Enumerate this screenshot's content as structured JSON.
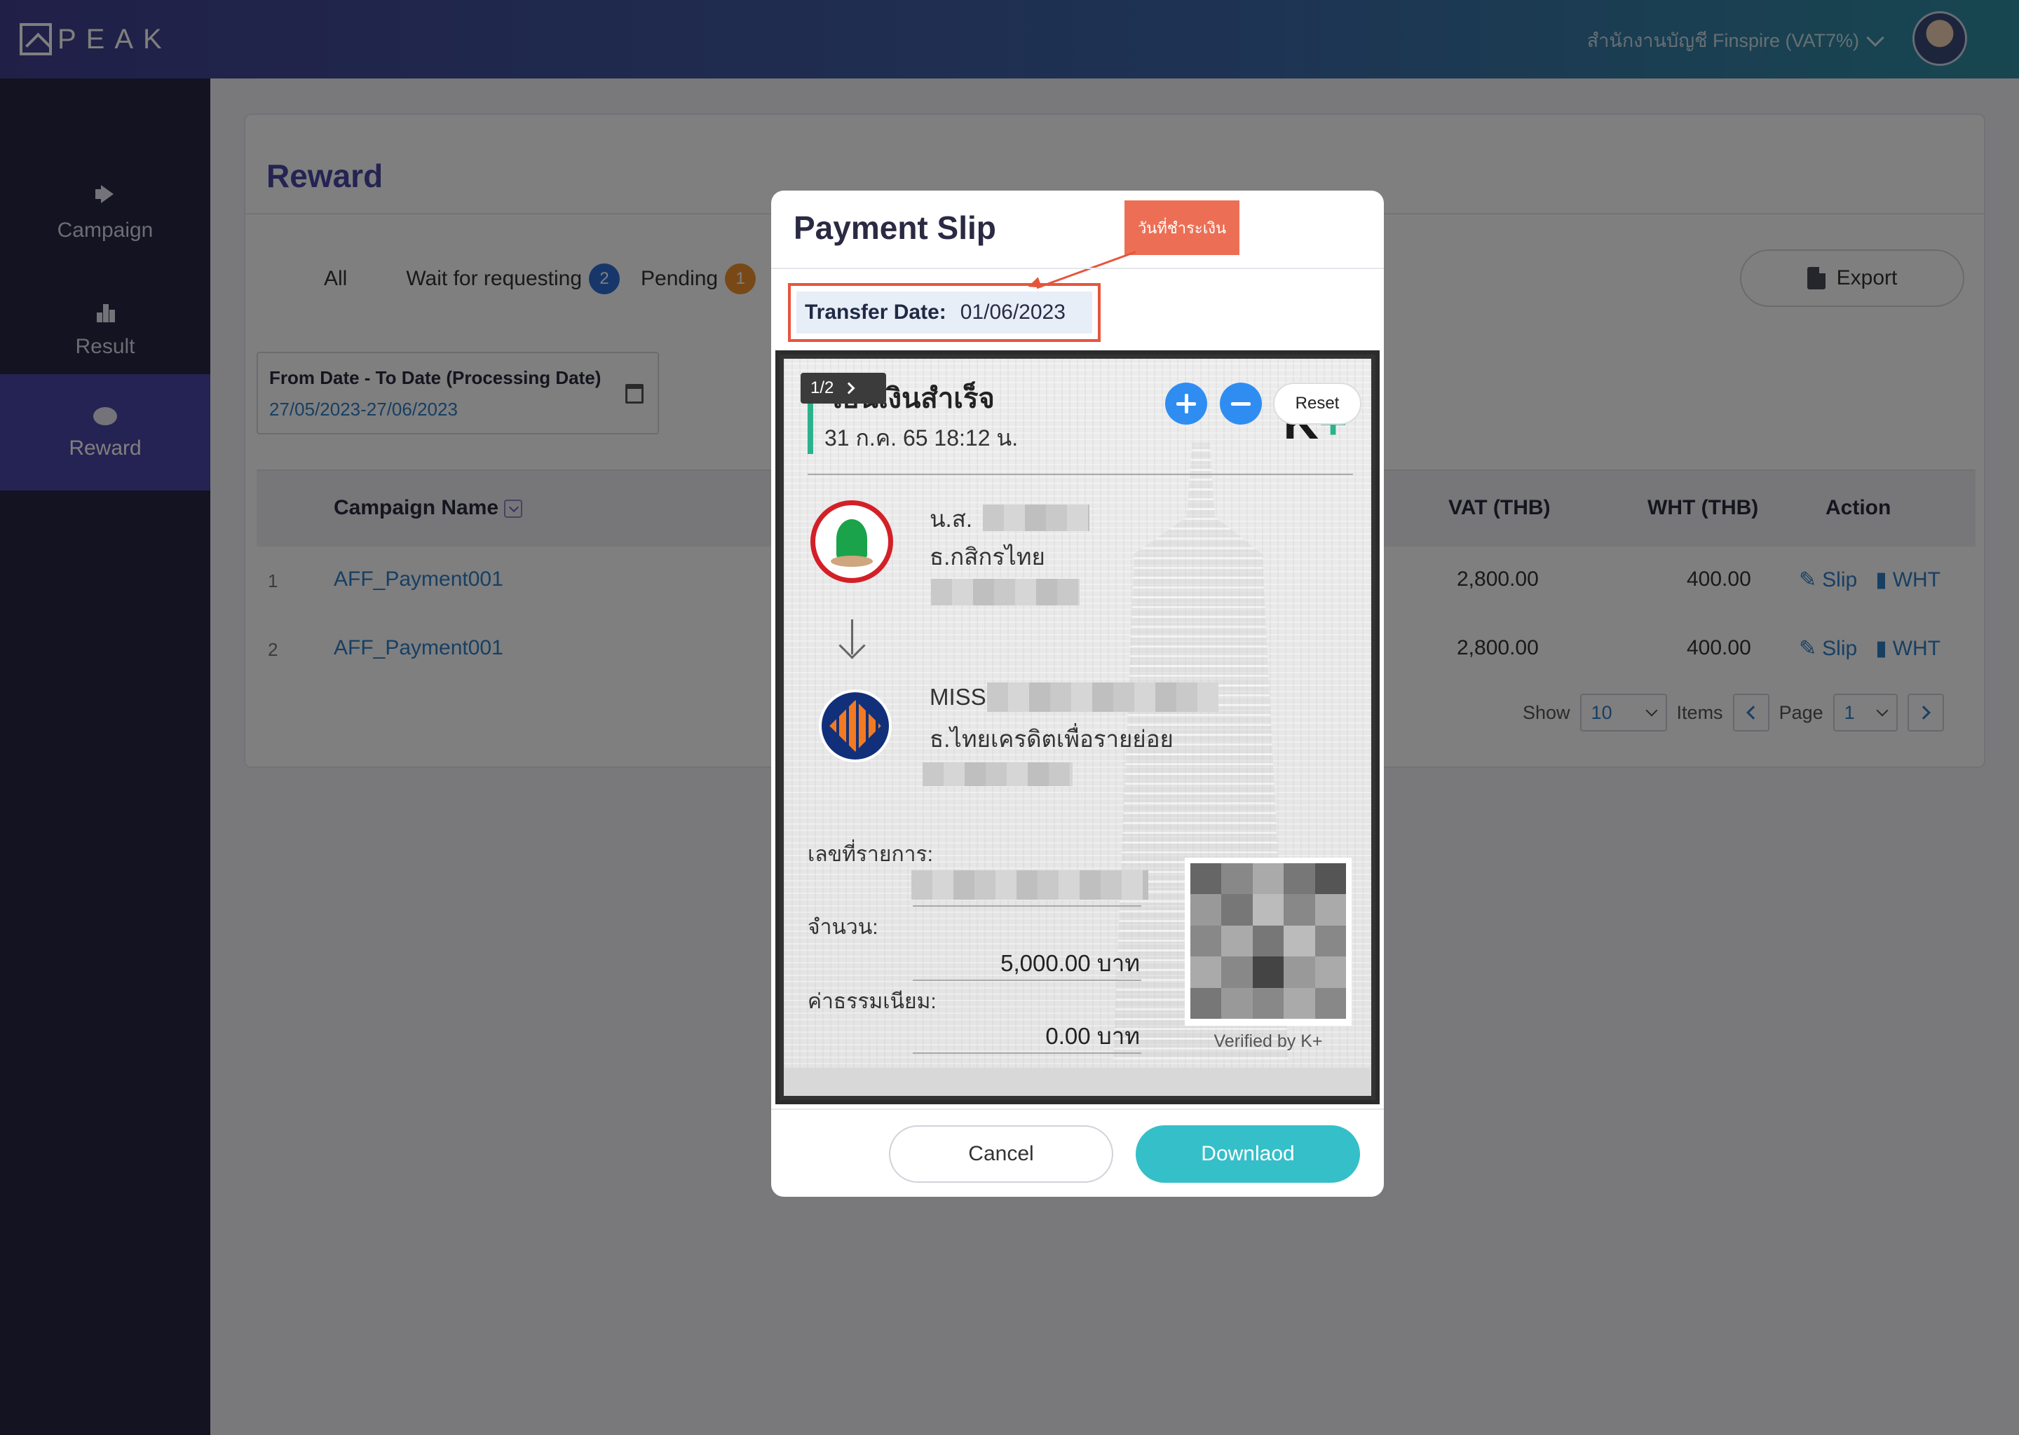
{
  "app": {
    "logo_text": "PEAK",
    "org_name": "สำนักงานบัญชี Finspire (VAT7%)"
  },
  "sidebar": {
    "items": [
      {
        "label": "Campaign",
        "icon": "megaphone-icon",
        "active": false
      },
      {
        "label": "Result",
        "icon": "bar-chart-icon",
        "active": false
      },
      {
        "label": "Reward",
        "icon": "piggy-bank-icon",
        "active": true
      }
    ]
  },
  "page": {
    "title": "Reward",
    "tabs": [
      {
        "label": "All"
      },
      {
        "label": "Wait for requesting",
        "count": "2"
      },
      {
        "label": "Pending",
        "count": "1"
      }
    ],
    "export_label": "Export",
    "date_filter": {
      "label": "From Date - To Date (Processing Date)",
      "value": "27/05/2023-27/06/2023"
    },
    "table": {
      "headers": {
        "campaign": "Campaign Name",
        "vat": "VAT (THB)",
        "wht": "WHT (THB)",
        "action": "Action"
      },
      "rows": [
        {
          "no": "1",
          "campaign": "AFF_Payment001",
          "vat": "2,800.00",
          "wht": "400.00",
          "slip": "Slip",
          "wht_link": "WHT"
        },
        {
          "no": "2",
          "campaign": "AFF_Payment001",
          "vat": "2,800.00",
          "wht": "400.00",
          "slip": "Slip",
          "wht_link": "WHT"
        }
      ]
    },
    "pagination": {
      "show_label": "Show",
      "page_size": "10",
      "items_label": "Items",
      "page_label": "Page",
      "page": "1"
    }
  },
  "modal": {
    "title": "Payment Slip",
    "callout": "วันที่ชำระเงิน",
    "transfer_label": "Transfer Date:",
    "transfer_date": "01/06/2023",
    "viewer": {
      "pager": "1/2",
      "reset_label": "Reset"
    },
    "slip": {
      "title": "โอนเงินสำเร็จ",
      "datetime": "31 ก.ค. 65  18:12 น.",
      "brand": "K+",
      "sender_prefix": "น.ส.",
      "sender_bank": "ธ.กสิกรไทย",
      "receiver_prefix": "MISS",
      "receiver_bank": "ธ.ไทยเครดิตเพื่อรายย่อย",
      "ref_label": "เลขที่รายการ:",
      "amount_label": "จำนวน:",
      "amount": "5,000.00 บาท",
      "fee_label": "ค่าธรรมเนียม:",
      "fee": "0.00 บาท",
      "verified": "Verified by K+"
    },
    "cancel_label": "Cancel",
    "download_label": "Downlaod"
  }
}
